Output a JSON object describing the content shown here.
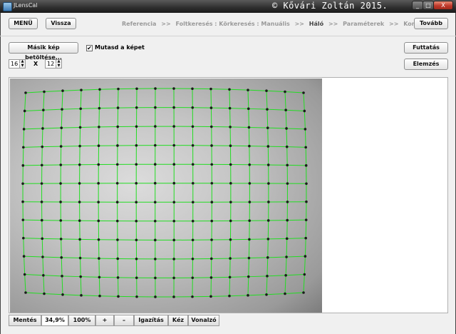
{
  "window": {
    "title": "JLensCal",
    "copyright": "© Kővári Zoltán 2015.",
    "controls": [
      "_",
      "□",
      "X"
    ]
  },
  "toolbar": {
    "menu_label": "MENÜ",
    "back_label": "Vissza",
    "next_label": "Tovább"
  },
  "breadcrumb": {
    "steps": [
      "Referencia",
      "Foltkeresés : Körkeresés : Manuális",
      "Háló",
      "Paraméterek",
      "Korrekció"
    ],
    "separator": ">>",
    "active_index": 2
  },
  "controls": {
    "load_other_image_label": "Másik kép betöltése...",
    "show_image_label": "Mutasd a képet",
    "show_image_checked": true,
    "run_label": "Futtatás",
    "analysis_label": "Elemzés",
    "grid_cols": "16",
    "grid_rows": "12",
    "times_label": "X"
  },
  "statusbar": {
    "save_label": "Mentés",
    "zoom_value": "34,9%",
    "zoom_100_label": "100%",
    "zoom_in_label": "+",
    "zoom_out_label": "–",
    "fit_label": "Igazítás",
    "hand_label": "Kéz",
    "ruler_label": "Vonalzó"
  },
  "image": {
    "grid_line_color": "#22dd22",
    "dot_color": "#1a1a1a",
    "vignette": true
  }
}
